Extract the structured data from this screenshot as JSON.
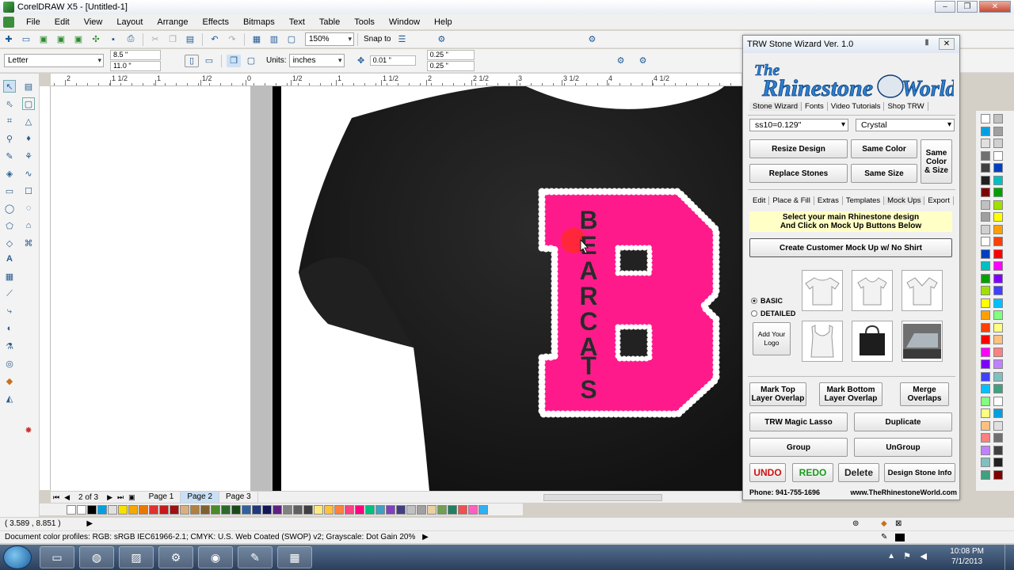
{
  "window": {
    "title": "CorelDRAW X5 - [Untitled-1]"
  },
  "menu": [
    "File",
    "Edit",
    "View",
    "Layout",
    "Arrange",
    "Effects",
    "Bitmaps",
    "Text",
    "Table",
    "Tools",
    "Window",
    "Help"
  ],
  "toolbar": {
    "zoom": "150%",
    "snap_to": "Snap to"
  },
  "propbar": {
    "paper": "Letter",
    "width": "8.5 \"",
    "height": "11.0 \"",
    "units_label": "Units:",
    "units": "inches",
    "nudge": "0.01 \"",
    "dup_x": "0.25 \"",
    "dup_y": "0.25 \""
  },
  "ruler_labels": [
    "2",
    "1 1/2",
    "1",
    "1/2",
    "0",
    "1/2",
    "1",
    "1 1/2",
    "2",
    "2 1/2",
    "3",
    "3 1/2",
    "4",
    "4 1/2"
  ],
  "design": {
    "letters": [
      "B",
      "E",
      "A",
      "R",
      "C",
      "A",
      "T",
      "S"
    ]
  },
  "pages": {
    "counter": "2 of 3",
    "tabs": [
      "Page 1",
      "Page 2",
      "Page 3"
    ],
    "active": 1
  },
  "status": {
    "coords": "( 3.589 , 8.851 )",
    "profiles": "Document color profiles: RGB: sRGB IEC61966-2.1; CMYK: U.S. Web Coated (SWOP) v2; Grayscale: Dot Gain 20%"
  },
  "clock": {
    "time": "10:08 PM",
    "date": "7/1/2013"
  },
  "wizard": {
    "title": "TRW Stone Wizard Ver. 1.0",
    "logo_text": "The Rhinestone World",
    "top_tabs": [
      "Stone Wizard",
      "Fonts",
      "Video Tutorials",
      "Shop TRW"
    ],
    "stone_size": "ss10=0.129\"",
    "stone_color": "Crystal",
    "btn_resize": "Resize Design",
    "btn_same_color": "Same Color",
    "btn_same_color_size": "Same Color & Size",
    "btn_replace": "Replace Stones",
    "btn_same_size": "Same Size",
    "mid_tabs": [
      "Edit",
      "Place & Fill",
      "Extras",
      "Templates",
      "Mock Ups",
      "Export"
    ],
    "hint_line1": "Select your main Rhinestone design",
    "hint_line2": "And Click on Mock Up Buttons Below",
    "btn_mockup": "Create Customer Mock Up w/ No Shirt",
    "radio_basic": "BASIC",
    "radio_detailed": "DETAILED",
    "btn_logo": "Add Your Logo",
    "btn_mark_top": "Mark Top Layer Overlap",
    "btn_mark_bottom": "Mark Bottom Layer Overlap",
    "btn_merge": "Merge Overlaps",
    "btn_lasso": "TRW Magic Lasso",
    "btn_duplicate": "Duplicate",
    "btn_group": "Group",
    "btn_ungroup": "UnGroup",
    "btn_undo": "UNDO",
    "btn_redo": "REDO",
    "btn_delete": "Delete",
    "btn_info": "Design Stone Info",
    "phone": "Phone: 941-755-1696",
    "website": "www.TheRhinestoneWorld.com"
  },
  "colors": {
    "pink": "#ff1a8c",
    "shirt": "#1c1c1c",
    "undo": "#d01010",
    "redo": "#1a9a1a"
  }
}
